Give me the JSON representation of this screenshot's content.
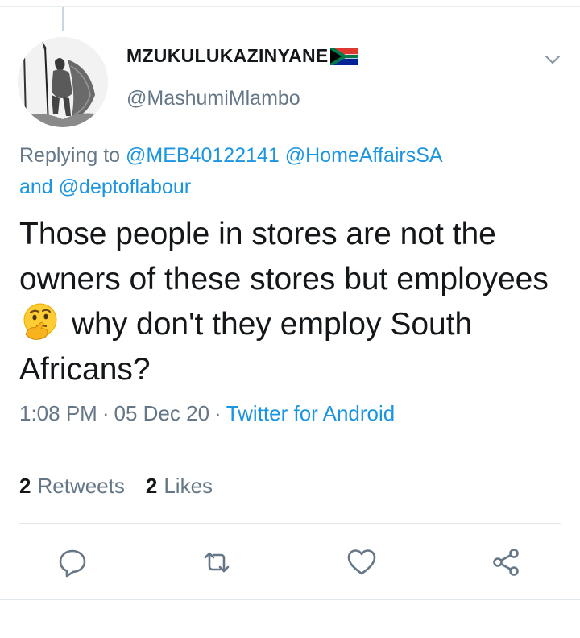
{
  "tweet": {
    "display_name": "MZUKULUKAZINYANE",
    "flag_icon": "south-africa-flag-emoji",
    "handle": "@MashumiMlambo",
    "reply": {
      "prefix": "Replying to",
      "mention_1": "@MEB40122141",
      "mention_2": "@HomeAffairsSA",
      "conjunction": "and",
      "mention_3": "@deptoflabour"
    },
    "text_before_emoji": "Those people in stores are not the owners of these stores but employees",
    "emoji": "thinking-face-emoji",
    "text_after_emoji": "why don't they employ South Africans?",
    "time": "1:08 PM",
    "separator": "·",
    "date": "05 Dec 20",
    "source": "Twitter for Android"
  },
  "stats": {
    "retweets_count": "2",
    "retweets_label": "Retweets",
    "likes_count": "2",
    "likes_label": "Likes"
  },
  "actions": [
    "reply-icon",
    "retweet-icon",
    "like-icon",
    "share-icon"
  ],
  "colors": {
    "link": "#1b95e0",
    "secondary_text": "#657786",
    "primary_text": "#14171a",
    "icon": "#657786"
  }
}
